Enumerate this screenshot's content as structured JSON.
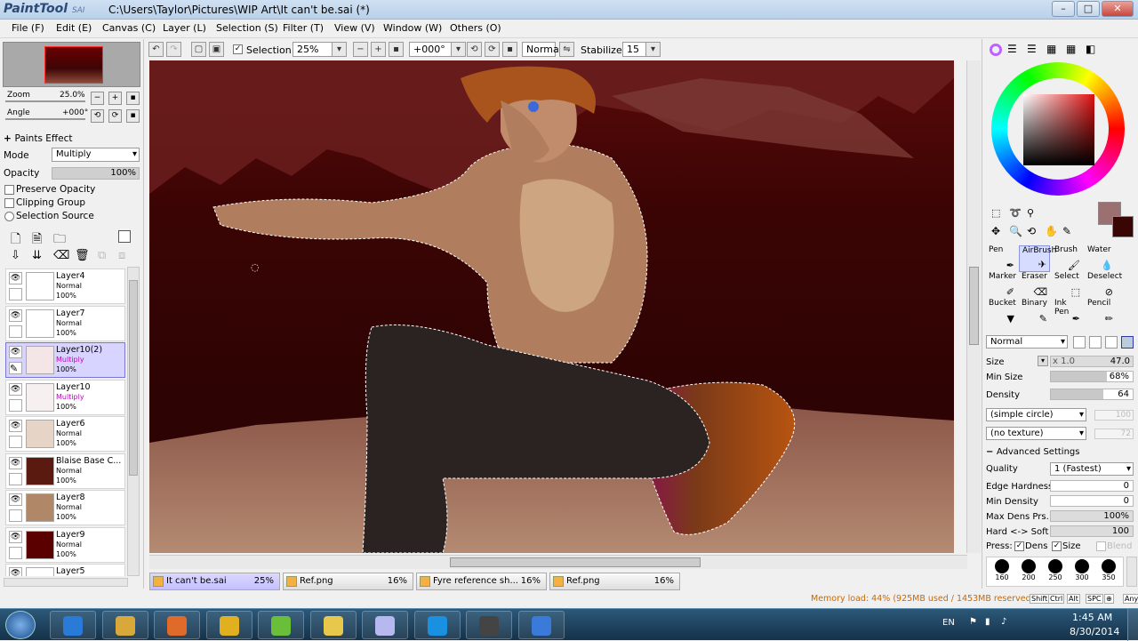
{
  "window": {
    "logo": "PaintTool",
    "logo_sub": "SAI",
    "title": "C:\\Users\\Taylor\\Pictures\\WIP Art\\It can't be.sai (*)",
    "minimize": "–",
    "maximize": "□",
    "close": "✕"
  },
  "menubar": [
    "File (F)",
    "Edit (E)",
    "Canvas (C)",
    "Layer (L)",
    "Selection (S)",
    "Filter (T)",
    "View (V)",
    "Window (W)",
    "Others (O)"
  ],
  "toolbar": {
    "selection_label": "Selection",
    "zoom": "25%",
    "angle": "+000°",
    "mode": "Normal",
    "stabilizer_label": "Stabilizer",
    "stabilizer": "15"
  },
  "navigator": {
    "zoom_label": "Zoom",
    "zoom_value": "25.0%",
    "angle_label": "Angle",
    "angle_value": "+000°"
  },
  "layer_props": {
    "paints_effect": "Paints Effect",
    "mode_label": "Mode",
    "mode_value": "Multiply",
    "opacity_label": "Opacity",
    "opacity_value": "100%",
    "preserve_opacity": "Preserve Opacity",
    "clipping_group": "Clipping Group",
    "selection_source": "Selection Source"
  },
  "layers": [
    {
      "name": "Layer4",
      "mode": "Normal",
      "opacity": "100%",
      "selected": false,
      "thumb": "#ffffff"
    },
    {
      "name": "Layer7",
      "mode": "Normal",
      "opacity": "100%",
      "selected": false,
      "thumb": "#ffffff"
    },
    {
      "name": "Layer10(2)",
      "mode": "Multiply",
      "opacity": "100%",
      "selected": true,
      "thumb": "#f4e6e6"
    },
    {
      "name": "Layer10",
      "mode": "Multiply",
      "opacity": "100%",
      "selected": false,
      "thumb": "#f7f0f0"
    },
    {
      "name": "Layer6",
      "mode": "Normal",
      "opacity": "100%",
      "selected": false,
      "thumb": "#e6d5c6"
    },
    {
      "name": "Blaise Base C...",
      "mode": "Normal",
      "opacity": "100%",
      "selected": false,
      "thumb": "#5a1a10"
    },
    {
      "name": "Layer8",
      "mode": "Normal",
      "opacity": "100%",
      "selected": false,
      "thumb": "#b08868"
    },
    {
      "name": "Layer9",
      "mode": "Normal",
      "opacity": "100%",
      "selected": false,
      "thumb": "#5a0000"
    },
    {
      "name": "Layer5",
      "mode": "",
      "opacity": "",
      "selected": false,
      "thumb": "#ffffff"
    }
  ],
  "tabs": [
    {
      "name": "It can't be.sai",
      "percent": "25%",
      "selected": true
    },
    {
      "name": "Ref.png",
      "percent": "16%",
      "selected": false
    },
    {
      "name": "Fyre reference sh...",
      "percent": "16%",
      "selected": false
    },
    {
      "name": "Ref.png",
      "percent": "16%",
      "selected": false
    }
  ],
  "tools": [
    {
      "name": "Pen",
      "selected": false
    },
    {
      "name": "AirBrush",
      "selected": true
    },
    {
      "name": "Brush",
      "selected": false
    },
    {
      "name": "Water",
      "selected": false
    },
    {
      "name": "Marker",
      "selected": false
    },
    {
      "name": "Eraser",
      "selected": false
    },
    {
      "name": "Select",
      "selected": false
    },
    {
      "name": "Deselect",
      "selected": false
    },
    {
      "name": "Bucket",
      "selected": false
    },
    {
      "name": "Binary",
      "selected": false
    },
    {
      "name": "Ink Pen",
      "selected": false
    },
    {
      "name": "Pencil",
      "selected": false
    }
  ],
  "brush": {
    "blend_mode": "Normal",
    "size_label": "Size",
    "size_mult": "x 1.0",
    "size_value": "47.0",
    "min_size_label": "Min Size",
    "min_size_value": "68%",
    "min_size_fraction": 0.68,
    "density_label": "Density",
    "density_value": "64",
    "density_fraction": 0.64,
    "shape": "(simple circle)",
    "shape_num": "100",
    "texture": "(no texture)",
    "texture_num": "72",
    "advanced_label": "Advanced Settings",
    "quality_label": "Quality",
    "quality_value": "1 (Fastest)",
    "edge_hardness_label": "Edge Hardness",
    "edge_hardness_value": "0",
    "min_density_label": "Min Density",
    "min_density_value": "0",
    "max_dens_label": "Max Dens Prs.",
    "max_dens_value": "100%",
    "hard_soft_label": "Hard <-> Soft",
    "hard_soft_value": "100",
    "press_label": "Press:",
    "press_dens": "Dens",
    "press_size": "Size",
    "press_blend": "Blend"
  },
  "brush_sizes": [
    "160",
    "200",
    "250",
    "300",
    "350"
  ],
  "colors": {
    "primary": "#9a7070",
    "secondary": "#3a0505",
    "accent": "#c86a00"
  },
  "status": {
    "memory": "Memory load: 44% (925MB used / 1453MB reserved)",
    "keys": [
      "Shift",
      "Ctrl",
      "Alt",
      "SPC",
      "⊕",
      "Any"
    ]
  },
  "taskbar": {
    "apps": [
      "internet-explorer",
      "file-explorer",
      "media-player",
      "chrome",
      "paint-tool",
      "folder",
      "arc",
      "skype",
      "app",
      "itunes"
    ],
    "lang": "EN",
    "time": "1:45 AM",
    "date": "8/30/2014"
  }
}
